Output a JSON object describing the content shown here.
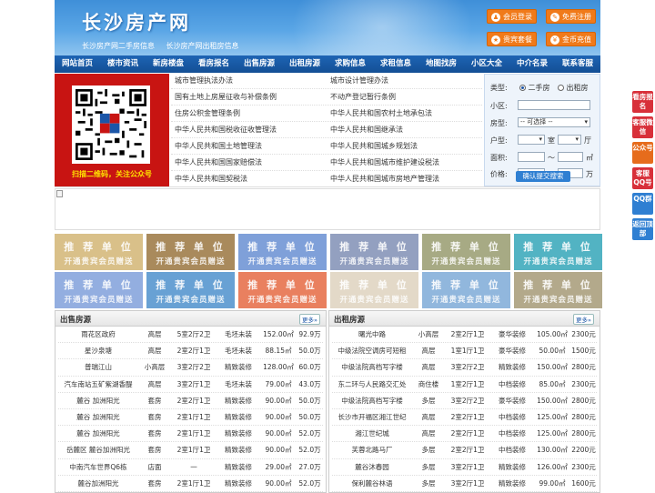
{
  "header": {
    "title": "长沙房产网",
    "sub_links": [
      "长沙房产网二手房信息",
      "长沙房产网出租房信息"
    ],
    "buttons": [
      {
        "label": "会员登录",
        "icon": "user-icon"
      },
      {
        "label": "免费注册",
        "icon": "register-icon"
      },
      {
        "label": "贵宾套餐",
        "icon": "vip-icon"
      },
      {
        "label": "金币充值",
        "icon": "coin-icon"
      }
    ]
  },
  "nav": [
    "网站首页",
    "楼市资讯",
    "新房楼盘",
    "看房报名",
    "出售房源",
    "出租房源",
    "求购信息",
    "求租信息",
    "地图找房",
    "小区大全",
    "中介名录",
    "联系客服"
  ],
  "qr_caption": "扫描二维码，关注公众号",
  "law_links": [
    [
      "城市管理执法办法",
      "城市设计管理办法"
    ],
    [
      "国有土地上房屋征收与补偿条例",
      "不动产登记暂行条例"
    ],
    [
      "住房公积金管理条例",
      "中华人民共和国农村土地承包法"
    ],
    [
      "中华人民共和国税收征收管理法",
      "中华人民共和国继承法"
    ],
    [
      "中华人民共和国土地管理法",
      "中华人民共和国城乡规划法"
    ],
    [
      "中华人民共和国国家赔偿法",
      "中华人民共和国城市维护建设税法"
    ],
    [
      "中华人民共和国契税法",
      "中华人民共和国城市房地产管理法"
    ]
  ],
  "search": {
    "type_label": "类型:",
    "type_options": [
      "二手房",
      "出租房"
    ],
    "community_label": "小区:",
    "room_label": "房型:",
    "room_value": "-- 可选择 --",
    "layout_label": "户型:",
    "room_unit": "室",
    "hall_unit": "厅",
    "area_label": "面积:",
    "area_sep": "～",
    "area_unit": "㎡",
    "price_label": "价格:",
    "price_sep": "～",
    "price_unit": "万",
    "submit_label": "确认提交搜索"
  },
  "recommend": {
    "line1": "推 荐 单 位",
    "line2": "开通贵宾会员赠送",
    "colors": [
      "#d9c089",
      "#a98a5c",
      "#7fa0d9",
      "#93a0c0",
      "#a7aa84",
      "#52b3c3",
      "#93aee0",
      "#68a1d4",
      "#e9805f",
      "#e3d9c8",
      "#91b7dd",
      "#b3a98b"
    ]
  },
  "sale": {
    "title": "出售房源",
    "more": "更多»",
    "rows": [
      [
        "雨花区政府",
        "高层",
        "5室2厅2卫",
        "毛坯未装",
        "152.00㎡",
        "92.9万"
      ],
      [
        "星沙泉塘",
        "高层",
        "2室2厅1卫",
        "毛坯未装",
        "88.15㎡",
        "50.0万"
      ],
      [
        "普瑞江山",
        "小高层",
        "3室2厅2卫",
        "精致装修",
        "128.00㎡",
        "60.0万"
      ],
      [
        "汽车南站五矿紫湖香醍",
        "高层",
        "3室2厅1卫",
        "毛坯未装",
        "79.00㎡",
        "43.0万"
      ],
      [
        "麓谷 加洲阳光",
        "套房",
        "2室2厅1卫",
        "精致装修",
        "90.00㎡",
        "50.0万"
      ],
      [
        "麓谷 加洲阳光",
        "套房",
        "2室1厅1卫",
        "精致装修",
        "90.00㎡",
        "50.0万"
      ],
      [
        "麓谷 加洲阳光",
        "套房",
        "2室1厅1卫",
        "精致装修",
        "90.00㎡",
        "52.0万"
      ],
      [
        "岳麓区 麓谷加洲阳光",
        "套房",
        "2室1厅1卫",
        "精致装修",
        "90.00㎡",
        "52.0万"
      ],
      [
        "中南汽车世界Q6栋",
        "店面",
        "一",
        "精致装修",
        "29.00㎡",
        "27.0万"
      ],
      [
        "麓谷加洲阳光",
        "套房",
        "2室1厅1卫",
        "精致装修",
        "90.00㎡",
        "52.0万"
      ]
    ]
  },
  "rent": {
    "title": "出租房源",
    "more": "更多»",
    "rows": [
      [
        "曙光中路",
        "小高层",
        "2室2厅1卫",
        "豪华装修",
        "105.00㎡",
        "2300元"
      ],
      [
        "中级法院空调房可短租",
        "高层",
        "1室1厅1卫",
        "豪华装修",
        "50.00㎡",
        "1500元"
      ],
      [
        "中级法院高档写字楼",
        "高层",
        "3室2厅2卫",
        "精致装修",
        "150.00㎡",
        "2800元"
      ],
      [
        "东二环与人民路交汇处",
        "商住楼",
        "1室2厅1卫",
        "中档装修",
        "85.00㎡",
        "2300元"
      ],
      [
        "中级法院高档写字楼",
        "多层",
        "3室2厅2卫",
        "豪华装修",
        "150.00㎡",
        "2800元"
      ],
      [
        "长沙市开福区湘江世纪",
        "高层",
        "2室2厅1卫",
        "中档装修",
        "125.00㎡",
        "2800元"
      ],
      [
        "湘江世纪城",
        "高层",
        "2室2厅1卫",
        "中档装修",
        "125.00㎡",
        "2800元"
      ],
      [
        "芙蓉北路马厂",
        "多层",
        "2室2厅1卫",
        "中档装修",
        "130.00㎡",
        "2200元"
      ],
      [
        "麓谷沐春园",
        "多层",
        "3室2厅1卫",
        "精致装修",
        "126.00㎡",
        "2300元"
      ],
      [
        "保利麓谷林语",
        "多层",
        "3室2厅1卫",
        "精致装修",
        "99.00㎡",
        "1600元"
      ]
    ]
  },
  "side_tabs": [
    {
      "label": "看房报名",
      "color": "#d8303a"
    },
    {
      "label": "客服微信",
      "color": "#d8303a"
    },
    {
      "label": "公众号",
      "color": "#e66c1c"
    },
    {
      "label": "客服QQ号",
      "color": "#d8303a"
    },
    {
      "label": "QQ群",
      "color": "#2f7fd2"
    },
    {
      "label": "返回顶部",
      "color": "#2f7fd2"
    }
  ]
}
